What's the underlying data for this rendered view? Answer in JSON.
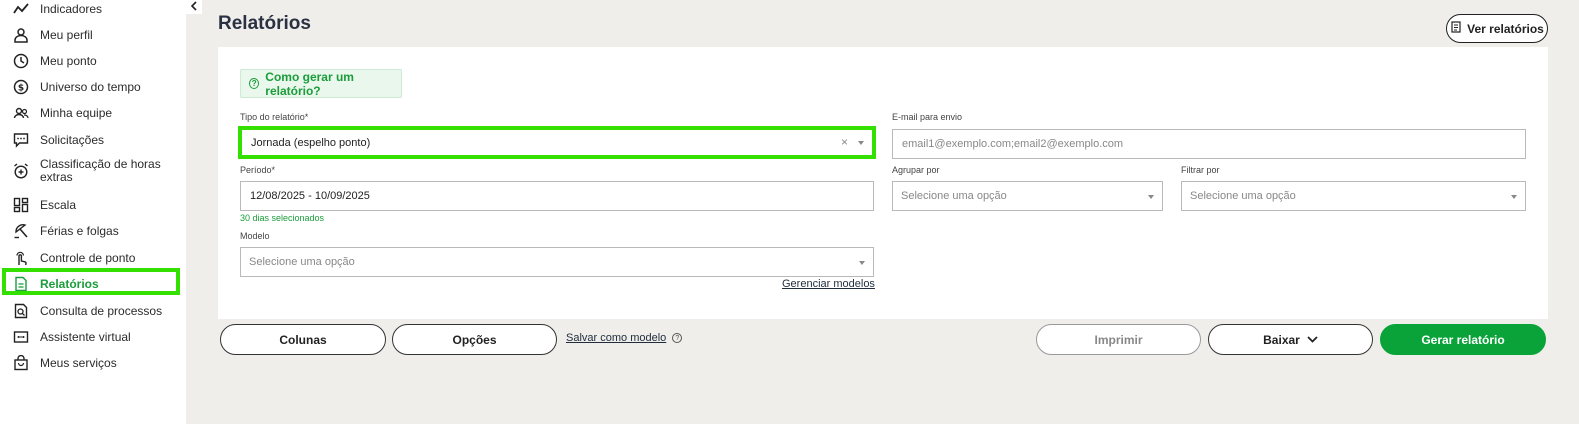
{
  "sidebar": {
    "items": [
      {
        "label": "Indicadores",
        "icon": "chart-line-icon"
      },
      {
        "label": "Meu perfil",
        "icon": "user-icon"
      },
      {
        "label": "Meu ponto",
        "icon": "clock-icon"
      },
      {
        "label": "Universo do tempo",
        "icon": "dollar-circle-icon"
      },
      {
        "label": "Minha equipe",
        "icon": "team-icon"
      },
      {
        "label": "Solicitações",
        "icon": "chat-icon"
      },
      {
        "label": "Classificação de horas extras",
        "icon": "alarm-plus-icon"
      },
      {
        "label": "Escala",
        "icon": "grid-icon"
      },
      {
        "label": "Férias e folgas",
        "icon": "beach-umbrella-icon"
      },
      {
        "label": "Controle de ponto",
        "icon": "touch-icon"
      },
      {
        "label": "Relatórios",
        "icon": "document-icon"
      },
      {
        "label": "Consulta de processos",
        "icon": "search-document-icon"
      },
      {
        "label": "Assistente virtual",
        "icon": "robot-icon"
      },
      {
        "label": "Meus serviços",
        "icon": "bag-icon"
      }
    ],
    "active": "Relatórios"
  },
  "header": {
    "title": "Relatórios",
    "ver_relatorios": "Ver relatórios"
  },
  "form": {
    "help": "Como gerar um relatório?",
    "tipo_label": "Tipo do relatório*",
    "tipo_value": "Jornada (espelho ponto)",
    "email_label": "E-mail para envio",
    "email_placeholder": "email1@exemplo.com;email2@exemplo.com",
    "periodo_label": "Período*",
    "periodo_value": "12/08/2025 - 10/09/2025",
    "periodo_hint": "30 dias selecionados",
    "agrupar_label": "Agrupar por",
    "agrupar_placeholder": "Selecione uma opção",
    "filtrar_label": "Filtrar por",
    "filtrar_placeholder": "Selecione uma opção",
    "modelo_label": "Modelo",
    "modelo_placeholder": "Selecione uma opção",
    "gerenciar": "Gerenciar modelos"
  },
  "actions": {
    "colunas": "Colunas",
    "opcoes": "Opções",
    "salvar": "Salvar como modelo",
    "imprimir": "Imprimir",
    "baixar": "Baixar",
    "gerar": "Gerar relatório"
  },
  "colors": {
    "accent": "#0aa33a",
    "highlight": "#33e000"
  }
}
